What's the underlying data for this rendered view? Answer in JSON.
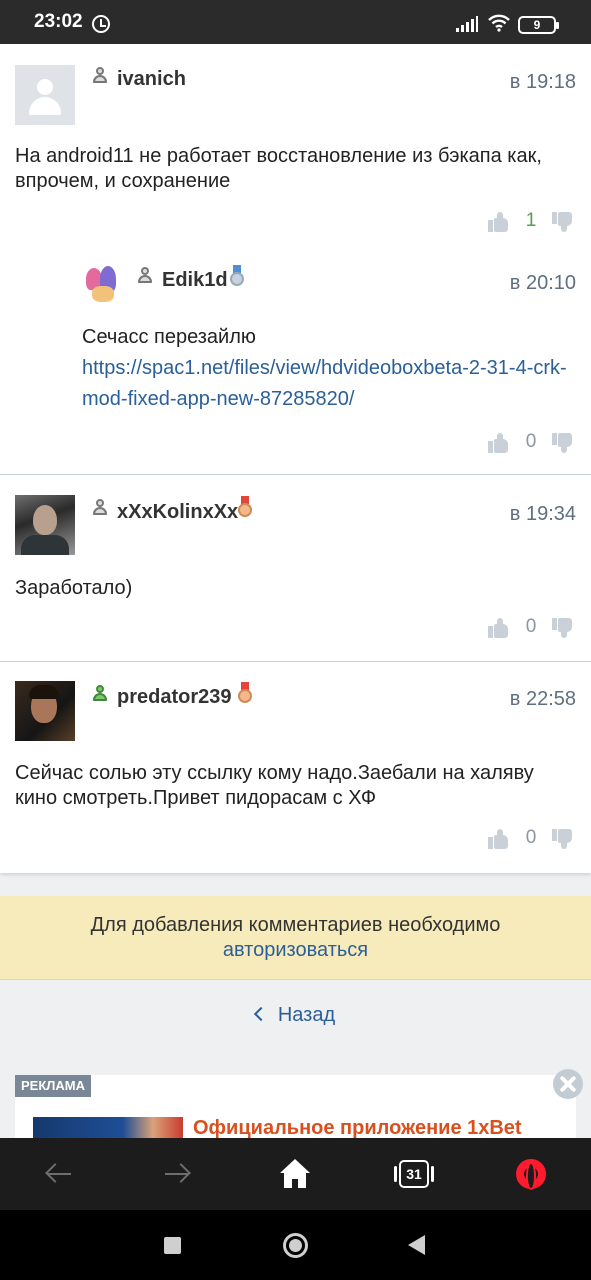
{
  "status_bar": {
    "time": "23:02",
    "battery": "9"
  },
  "comments": [
    {
      "username": "ivanich",
      "time": "в 19:18",
      "text": "На android11 не работает восстановление из бэкапа как, впрочем, и сохранение",
      "votes": "1"
    },
    {
      "username": "Edik1d",
      "time": "в 20:10",
      "text": "Сечасс перезайлю",
      "link": "https://spac1.net/files/view/hdvideoboxbeta-2-31-4-crk-mod-fixed-app-new-87285820/",
      "votes": "0"
    },
    {
      "username": "xXxKolinxXx",
      "time": "в 19:34",
      "text": "Заработало)",
      "votes": "0"
    },
    {
      "username": "predator239",
      "time": "в 22:58",
      "text": "Сейчас солью эту ссылку кому надо.Заебали на халяву кино смотреть.Привет пидорасам с ХФ",
      "votes": "0"
    }
  ],
  "auth_notice": {
    "text": "Для добавления комментариев необходимо",
    "link": "авторизоваться"
  },
  "back_link": "Назад",
  "ad": {
    "tag": "РЕКЛАМА",
    "title": "Официальное приложение 1xBet"
  },
  "browser_bar": {
    "tabs_count": "31"
  },
  "colors": {
    "link": "#2a5f99",
    "positive_vote": "#53a14a",
    "notice_bg": "#f7ebbc",
    "opera_red": "#ff1b2d"
  }
}
